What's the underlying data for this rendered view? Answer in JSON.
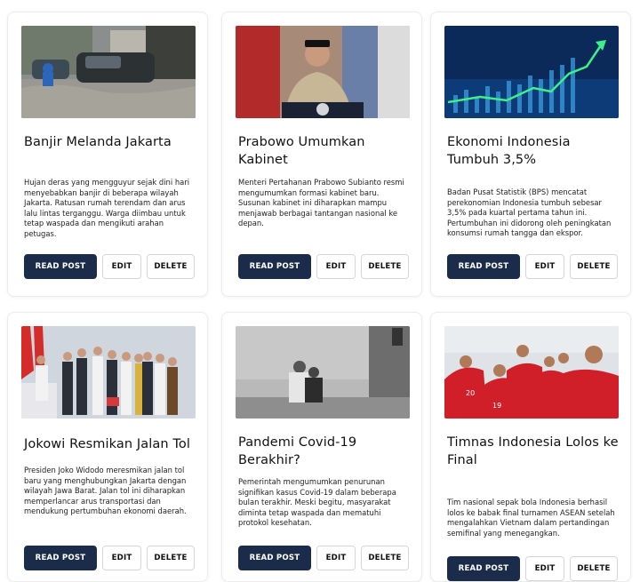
{
  "buttons": {
    "read": "READ POST",
    "edit": "EDIT",
    "delete": "DELETE"
  },
  "posts": [
    {
      "title": "Banjir Melanda Jakarta",
      "description": "Hujan deras yang mengguyur sejak dini hari menyebabkan banjir di beberapa wilayah Jakarta. Ratusan rumah terendam dan arus lalu lintas terganggu. Warga diimbau untuk tetap waspada dan mengikuti arahan petugas."
    },
    {
      "title": "Prabowo Umumkan Kabinet",
      "description": "Menteri Pertahanan Prabowo Subianto resmi mengumumkan formasi kabinet baru. Susunan kabinet ini diharapkan mampu menjawab berbagai tantangan nasional ke depan."
    },
    {
      "title": "Ekonomi Indonesia Tumbuh 3,5%",
      "description": "Badan Pusat Statistik (BPS) mencatat perekonomian Indonesia tumbuh sebesar 3,5% pada kuartal pertama tahun ini. Pertumbuhan ini didorong oleh peningkatan konsumsi rumah tangga dan ekspor."
    },
    {
      "title": "Jokowi Resmikan Jalan Tol",
      "description": "Presiden Joko Widodo meresmikan jalan tol baru yang menghubungkan Jakarta dengan wilayah Jawa Barat. Jalan tol ini diharapkan memperlancar arus transportasi dan mendukung pertumbuhan ekonomi daerah."
    },
    {
      "title": "Pandemi Covid-19 Berakhir?",
      "description": "Pemerintah mengumumkan penurunan signifikan kasus Covid-19 dalam beberapa bulan terakhir. Meski begitu, masyarakat diminta tetap waspada dan mematuhi protokol kesehatan."
    },
    {
      "title": "Timnas Indonesia Lolos ke Final",
      "description": "Tim nasional sepak bola Indonesia berhasil lolos ke babak final turnamen ASEAN setelah mengalahkan Vietnam dalam pertandingan semifinal yang menegangkan."
    }
  ],
  "colors": {
    "primary_button": "#1b2b4a",
    "card_border": "#ececec"
  },
  "images": [
    "flood-photo",
    "politician-speech-photo",
    "stock-chart-photo",
    "ribbon-cutting-photo",
    "people-masks-photo",
    "football-team-photo"
  ]
}
